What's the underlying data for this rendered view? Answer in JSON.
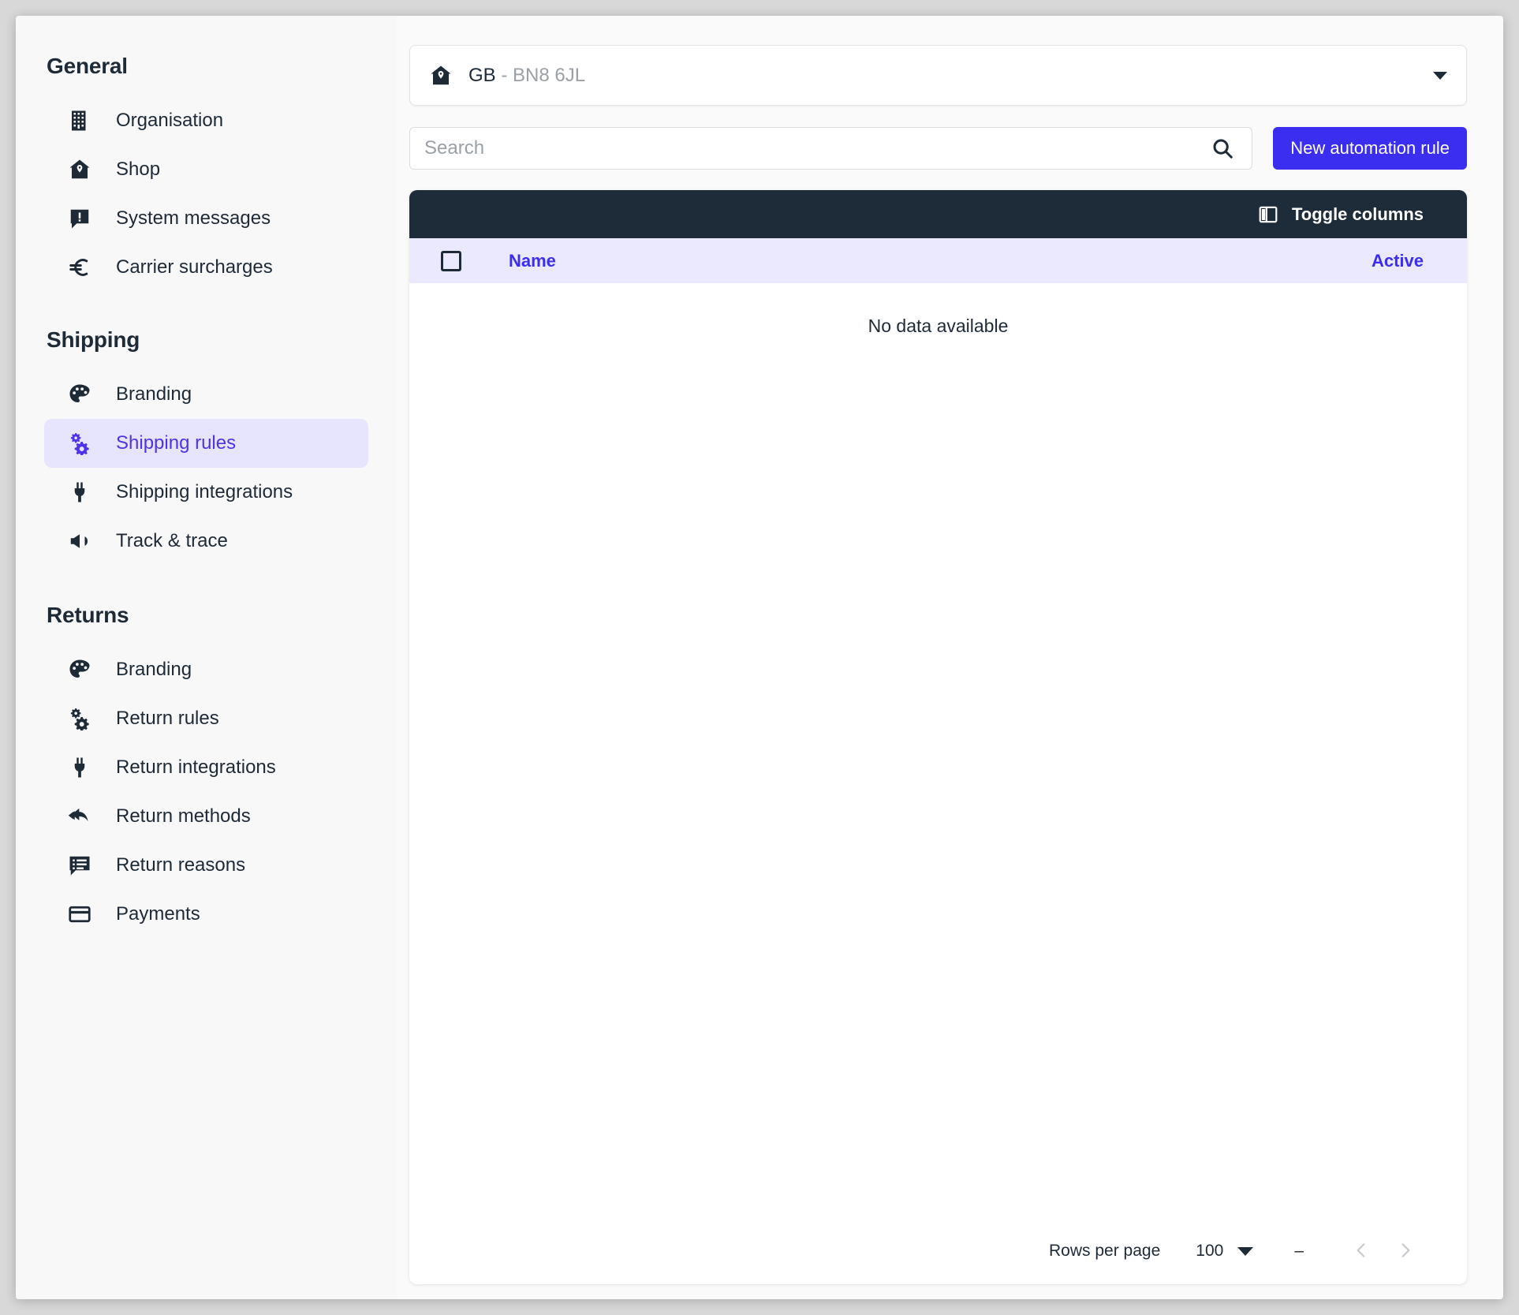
{
  "sidebar": {
    "groups": [
      {
        "title": "General",
        "items": [
          {
            "label": "Organisation",
            "icon": "building-icon",
            "active": false
          },
          {
            "label": "Shop",
            "icon": "shop-home-icon",
            "active": false
          },
          {
            "label": "System messages",
            "icon": "message-alert-icon",
            "active": false
          },
          {
            "label": "Carrier surcharges",
            "icon": "euro-icon",
            "active": false
          }
        ]
      },
      {
        "title": "Shipping",
        "items": [
          {
            "label": "Branding",
            "icon": "palette-icon",
            "active": false
          },
          {
            "label": "Shipping rules",
            "icon": "gears-icon",
            "active": true
          },
          {
            "label": "Shipping integrations",
            "icon": "plug-icon",
            "active": false
          },
          {
            "label": "Track & trace",
            "icon": "megaphone-icon",
            "active": false
          }
        ]
      },
      {
        "title": "Returns",
        "items": [
          {
            "label": "Branding",
            "icon": "palette-icon",
            "active": false
          },
          {
            "label": "Return rules",
            "icon": "gears-icon",
            "active": false
          },
          {
            "label": "Return integrations",
            "icon": "plug-icon",
            "active": false
          },
          {
            "label": "Return methods",
            "icon": "reply-all-icon",
            "active": false
          },
          {
            "label": "Return reasons",
            "icon": "message-list-icon",
            "active": false
          },
          {
            "label": "Payments",
            "icon": "credit-card-icon",
            "active": false
          }
        ]
      }
    ]
  },
  "shop_selector": {
    "icon": "shop-home-icon",
    "country": "GB",
    "separator": " - ",
    "postcode": "BN8 6JL",
    "caret_icon": "chevron-down-icon"
  },
  "search": {
    "placeholder": "Search",
    "value": "",
    "icon": "search-icon"
  },
  "actions": {
    "new_rule_label": "New automation rule"
  },
  "table": {
    "toolbar": {
      "toggle_columns_label": "Toggle columns",
      "toggle_columns_icon": "columns-icon"
    },
    "columns": [
      {
        "label": "Name",
        "key": "name"
      },
      {
        "label": "Active",
        "key": "active"
      }
    ],
    "select_all_checkbox": false,
    "rows": [],
    "empty_message": "No data available"
  },
  "pagination": {
    "rows_per_page_label": "Rows per page",
    "rows_per_page_value": "100",
    "range_text": "–",
    "prev_icon": "chevron-left-icon",
    "next_icon": "chevron-right-icon"
  },
  "colors": {
    "accent": "#3b2ef0",
    "accent_soft": "#e7e5fd",
    "header_row": "#ebe9fd",
    "toolbar_dark": "#1e2b38",
    "text": "#1f2a37",
    "muted": "#9aa0a6",
    "sidebar_bg": "#f8f8f9"
  }
}
